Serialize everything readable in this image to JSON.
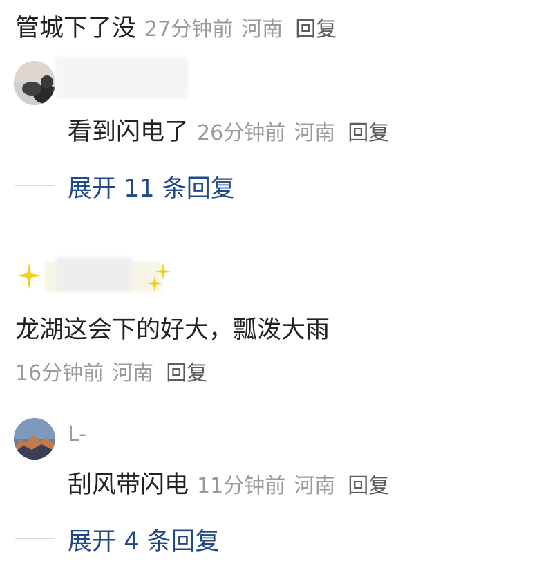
{
  "comments": [
    {
      "text": "管城下了没",
      "time": "27分钟前",
      "location": "河南",
      "reply_label": "回复"
    },
    {
      "username": "",
      "text": "看到闪电了",
      "time": "26分钟前",
      "location": "河南",
      "reply_label": "回复",
      "expand_label": "展开 11 条回复",
      "avatar_icon": "user-avatar-photo"
    },
    {
      "username": "",
      "text": "龙湖这会下的好大，瓢泼大雨",
      "time": "16分钟前",
      "location": "河南",
      "reply_label": "回复",
      "decoration_icon": "sparkle-icon"
    },
    {
      "username": "L-",
      "text": "刮风带闪电",
      "time": "11分钟前",
      "location": "河南",
      "reply_label": "回复",
      "expand_label": "展开 4 条回复",
      "avatar_icon": "mountain-sunset-avatar"
    }
  ],
  "colors": {
    "text": "#222222",
    "meta": "#9a9a9a",
    "link": "#1f4a86",
    "sparkle": "#f2cf1d"
  }
}
